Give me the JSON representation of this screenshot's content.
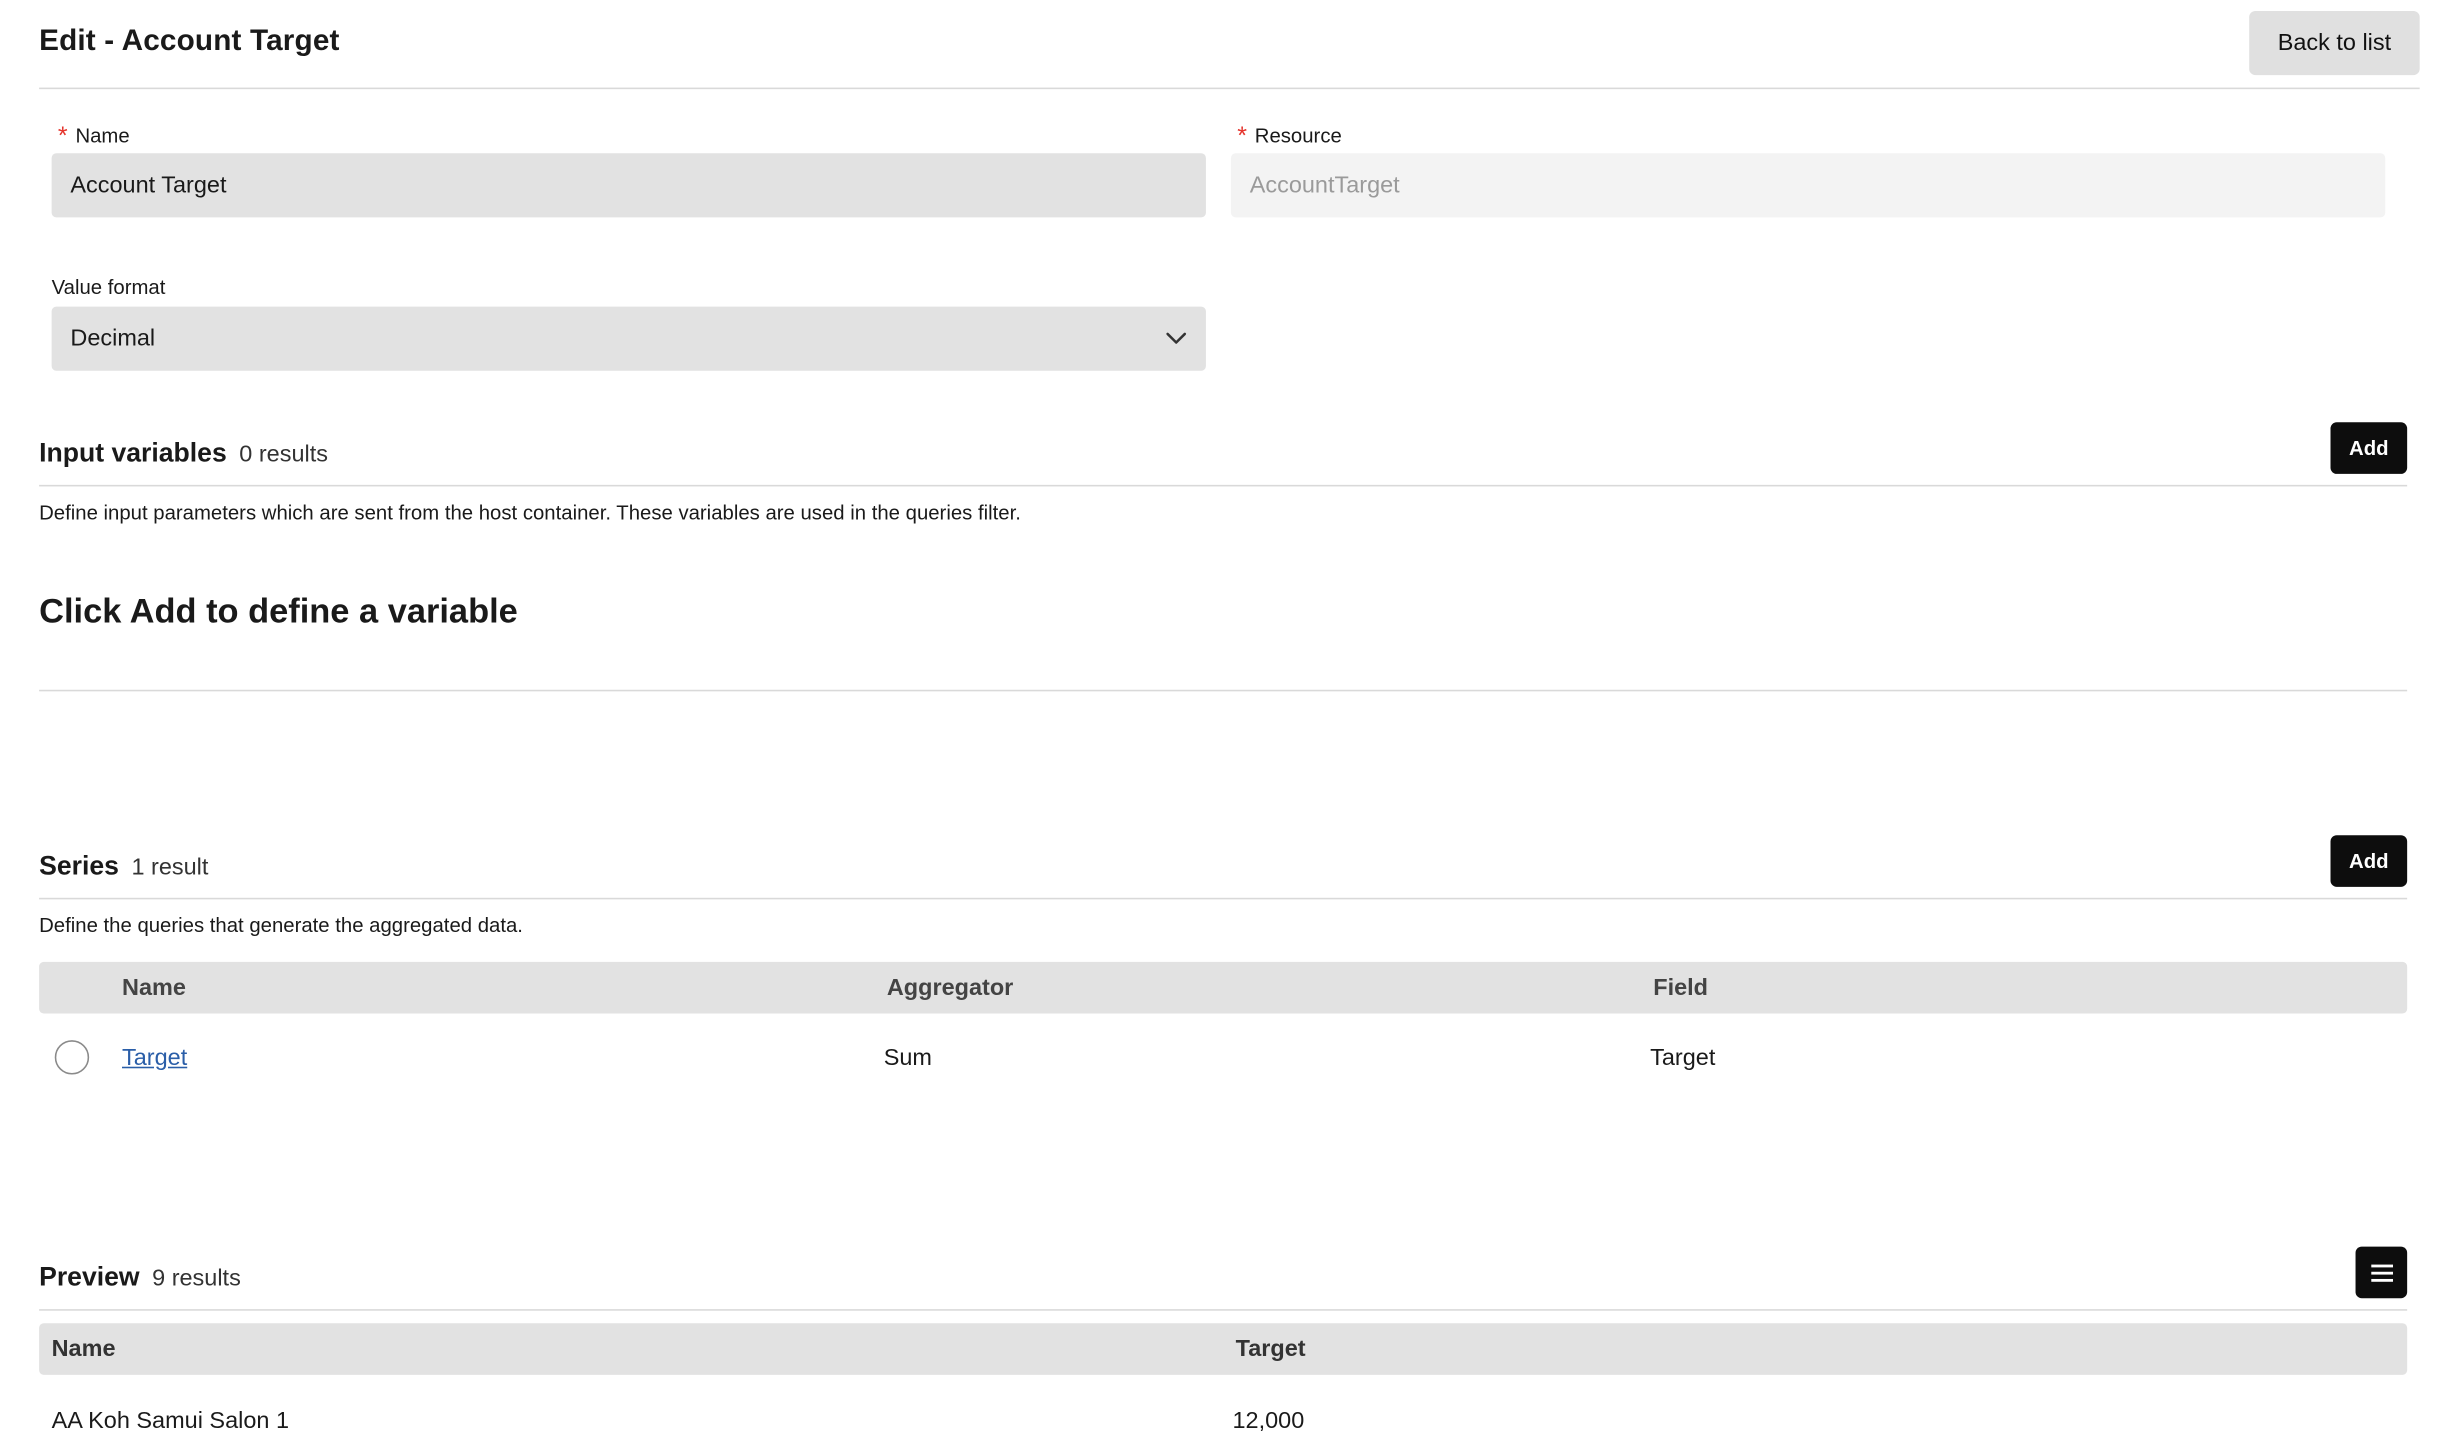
{
  "header": {
    "title": "Edit - Account Target",
    "back_label": "Back to list"
  },
  "form": {
    "name_label": "Name",
    "name_value": "Account Target",
    "resource_label": "Resource",
    "resource_value": "AccountTarget",
    "value_format_label": "Value format",
    "value_format_value": "Decimal"
  },
  "input_variables": {
    "title": "Input variables",
    "count": "0 results",
    "add_label": "Add",
    "description": "Define input parameters which are sent from the host container. These variables are used in the queries filter.",
    "empty_message": "Click Add to define a variable"
  },
  "series": {
    "title": "Series",
    "count": "1 result",
    "add_label": "Add",
    "description": "Define the queries that generate the aggregated data.",
    "columns": [
      "Name",
      "Aggregator",
      "Field"
    ],
    "rows": [
      {
        "name": "Target",
        "aggregator": "Sum",
        "field": "Target"
      }
    ]
  },
  "preview": {
    "title": "Preview",
    "count": "9 results",
    "columns": [
      "Name",
      "Target"
    ],
    "rows": [
      {
        "name": "AA Koh Samui Salon 1",
        "target": "12,000"
      }
    ]
  },
  "icons": {
    "required": "asterisk-icon",
    "select": "chevron-down-icon",
    "preview_menu": "menu-icon"
  },
  "colors": {
    "required": "#e5342c",
    "primary_button": "#0d0d0d",
    "link": "#2a5ea8"
  }
}
